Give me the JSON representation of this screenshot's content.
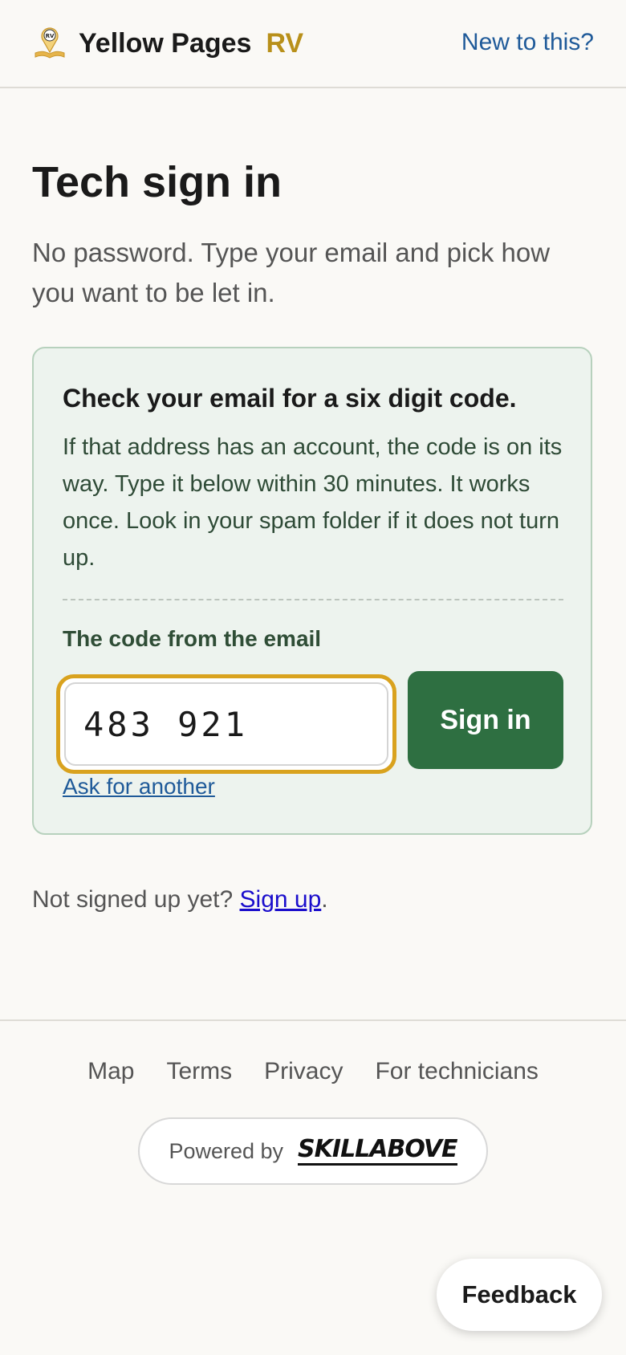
{
  "header": {
    "logo_icon_text": "RV",
    "brand_name": "Yellow Pages",
    "brand_suffix": "RV",
    "new_link": "New to this?"
  },
  "main": {
    "title": "Tech sign in",
    "subtitle": "No password. Type your email and pick how you want to be let in."
  },
  "card": {
    "heading": "Check your email for a six digit code.",
    "body": "If that address has an account, the code is on its way. Type it below within 30 minutes. It works once. Look in your spam folder if it does not turn up.",
    "code_label": "The code from the email",
    "code_value": "483 921",
    "sign_in_label": "Sign in",
    "ask_another": "Ask for another"
  },
  "signup": {
    "prefix": "Not signed up yet? ",
    "link": "Sign up",
    "suffix": "."
  },
  "footer": {
    "links": [
      "Map",
      "Terms",
      "Privacy",
      "For technicians"
    ],
    "powered_by": "Powered by",
    "partner_logo": "SKILLABOVE"
  },
  "feedback_label": "Feedback",
  "colors": {
    "accent_gold": "#d9a21e",
    "brand_rv": "#b8901a",
    "primary_green": "#2e6f41",
    "link_blue": "#1f5a99",
    "card_bg": "#edf3ee"
  }
}
